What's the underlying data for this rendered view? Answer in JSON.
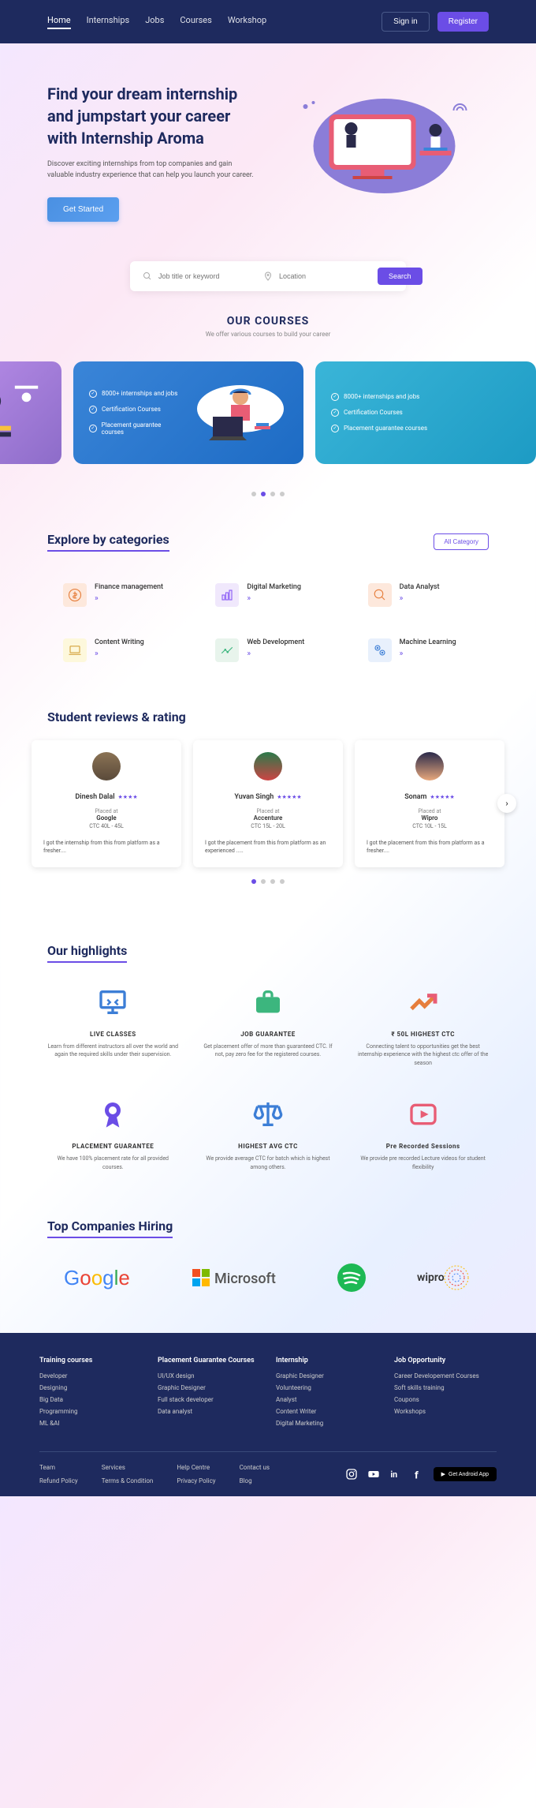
{
  "nav": {
    "home": "Home",
    "internships": "Internships",
    "jobs": "Jobs",
    "courses": "Courses",
    "workshop": "Workshop"
  },
  "auth": {
    "signin": "Sign in",
    "register": "Register"
  },
  "hero": {
    "title": "Find your dream internship and jumpstart your career with Internship Aroma",
    "desc": "Discover exciting internships from top companies and gain valuable industry experience that can help you launch your career.",
    "cta": "Get Started"
  },
  "search": {
    "placeholder1": "Job title or keyword",
    "placeholder2": "Location",
    "btn": "Search"
  },
  "courses_section": {
    "title": "OUR COURSES",
    "sub": "We offer various courses to build your career"
  },
  "course_items": [
    "8000+ internships and jobs",
    "Certification Courses",
    "Placement guarantee courses"
  ],
  "explore": {
    "title": "Explore by categories",
    "all": "All Category"
  },
  "categories": [
    {
      "name": "Finance management"
    },
    {
      "name": "Digital Marketing"
    },
    {
      "name": "Data Analyst"
    },
    {
      "name": "Content Writing"
    },
    {
      "name": "Web Development"
    },
    {
      "name": "Machine Learning"
    }
  ],
  "reviews_title": "Student reviews & rating",
  "reviews": [
    {
      "name": "Dinesh Dalal",
      "stars": "★★★★",
      "company": "Google",
      "ctc": "CTC 40L - 45L",
      "text": "I got the internship from this from platform as a fresher...."
    },
    {
      "name": "Yuvan Singh",
      "stars": "★★★★★",
      "company": "Accenture",
      "ctc": "CTC 15L - 20L",
      "text": "I got the placement from this from platform as an experienced ....."
    },
    {
      "name": "Sonam",
      "stars": "★★★★★",
      "company": "Wipro",
      "ctc": "CTC 10L - 15L",
      "text": "I got the placement from this from platform as a fresher...."
    }
  ],
  "placed_at": "Placed at",
  "highlights_title": "Our highlights",
  "highlights": [
    {
      "title": "LIVE CLASSES",
      "desc": "Learn from different instructors all over the world and again the required skills under their supervision."
    },
    {
      "title": "JOB GUARANTEE",
      "desc": "Get placement offer of more than guaranteed CTC. If not, pay zero fee for the registered courses."
    },
    {
      "title": "₹ 50L HIGHEST CTC",
      "desc": "Connecting talent to opportunities get the best internship experience with the highest ctc offer of the season"
    },
    {
      "title": "PLACEMENT GUARANTEE",
      "desc": "We have 100% placement rate for all provided courses."
    },
    {
      "title": "HIGHEST AVG CTC",
      "desc": "We provide average CTC for batch which is highest among others."
    },
    {
      "title": "Pre Recorded Sessions",
      "desc": "We provide pre recorded Lecture videos for student flexibility"
    }
  ],
  "companies_title": "Top Companies Hiring",
  "footer": {
    "col1": {
      "h": "Training courses",
      "links": [
        "Developer",
        "Designing",
        "Big Data",
        "Programming",
        "ML &AI"
      ]
    },
    "col2": {
      "h": "Placement Guarantee Courses",
      "links": [
        "UI/UX design",
        "Graphic Designer",
        "Full stack developer",
        "Data analyst"
      ]
    },
    "col3": {
      "h": "Internship",
      "links": [
        "Graphic Designer",
        "Volunteering",
        "Analyst",
        "Content Writer",
        "Digital Marketing"
      ]
    },
    "col4": {
      "h": "Job Opportunity",
      "links": [
        "Career Developement Courses",
        "Soft skills training",
        "Coupons",
        "Workshops"
      ]
    },
    "bottom": [
      "Team",
      "Services",
      "Help Centre",
      "Contact us",
      "Refund Policy",
      "Terms & Condition",
      "Privacy Policy",
      "Blog"
    ],
    "app": "Get Android App"
  }
}
